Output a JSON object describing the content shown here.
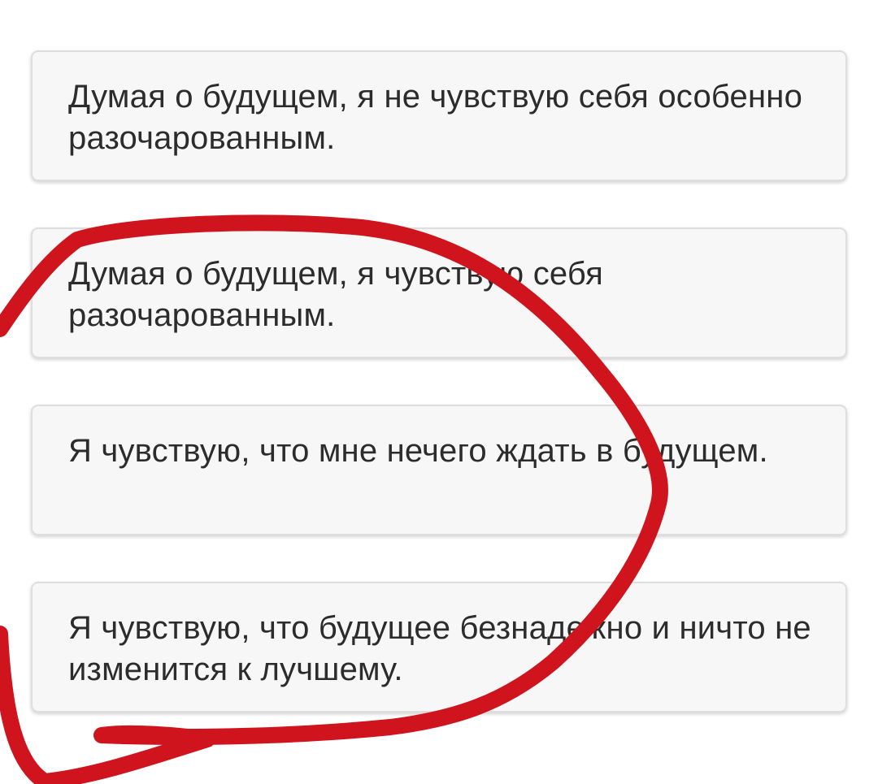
{
  "options": [
    {
      "text": "Думая о будущем, я не чувствую себя особенно разочарованным."
    },
    {
      "text": "Думая о будущем, я чувствую себя разочарованным."
    },
    {
      "text": "Я чувствую, что мне нечего ждать в будущем."
    },
    {
      "text": "Я чувствую, что будущее безнадежно и ничто не изменится к лучшему."
    }
  ],
  "annotation": {
    "type": "hand-drawn-circle",
    "color": "#d0141e"
  }
}
